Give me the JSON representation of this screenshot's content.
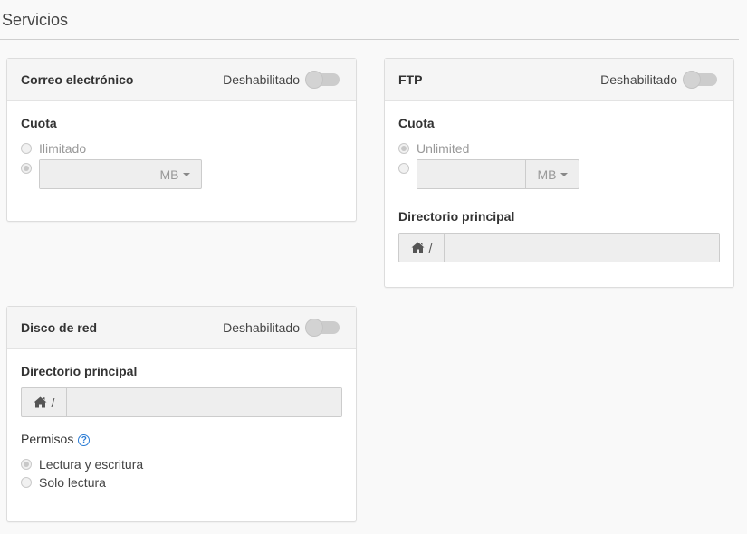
{
  "page": {
    "section_title": "Servicios"
  },
  "email": {
    "title": "Correo electrónico",
    "switch_label": "Deshabilitado",
    "quota_label": "Cuota",
    "unlimited_label": "Ilimitado",
    "quota_value": "",
    "unit": "MB"
  },
  "ftp": {
    "title": "FTP",
    "switch_label": "Deshabilitado",
    "quota_label": "Cuota",
    "unlimited_label": "Unlimited",
    "quota_value": "",
    "unit": "MB",
    "home_label": "Directorio principal",
    "home_prefix": "/",
    "home_value": ""
  },
  "netdisk": {
    "title": "Disco de red",
    "switch_label": "Deshabilitado",
    "home_label": "Directorio principal",
    "home_prefix": "/",
    "home_value": "",
    "permissions_label": "Permisos",
    "permissions": [
      "Lectura y escritura",
      "Solo lectura"
    ]
  },
  "icons": {
    "home": "home-icon",
    "help": "question-circle-icon",
    "caret": "caret-down-icon"
  },
  "colors": {
    "help_blue": "#2a7bd4",
    "toggle_off": "#cccccc"
  }
}
